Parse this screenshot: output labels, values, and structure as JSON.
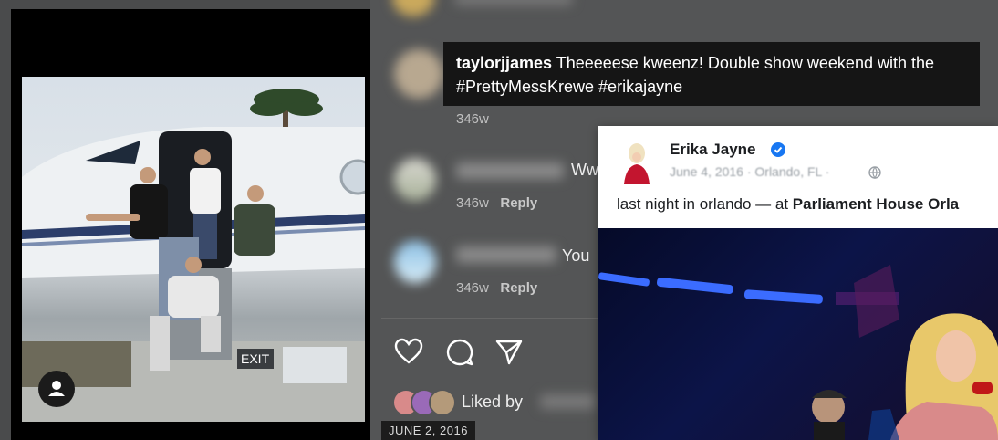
{
  "caption_comment": {
    "username": "taylorjjames",
    "text": " Theeeeese kweenz! Double show weekend with the #PrettyMessKrewe #erikajayne",
    "age": "346w"
  },
  "comments": [
    {
      "snippet": "Ww",
      "age": "346w",
      "reply_label": "Reply"
    },
    {
      "snippet": "You",
      "age": "346w",
      "reply_label": "Reply"
    }
  ],
  "actions": {
    "like_icon": "heart-icon",
    "comment_icon": "comment-icon",
    "share_icon": "send-icon"
  },
  "liked_by": {
    "label": "Liked by"
  },
  "post_date": "JUNE 2, 2016",
  "embedded_post": {
    "author": "Erika Jayne",
    "verified_icon": "verified-badge-icon",
    "meta": "June 4, 2016 · Orlando, FL ·",
    "globe_icon": "globe-icon",
    "text_prefix": "last night in orlando — at ",
    "place": "Parliament House Orla"
  },
  "user_icon": "user-icon",
  "colors": {
    "verified": "#1877f2",
    "caption_bg": "#151515",
    "panel_bg": "#545556"
  }
}
